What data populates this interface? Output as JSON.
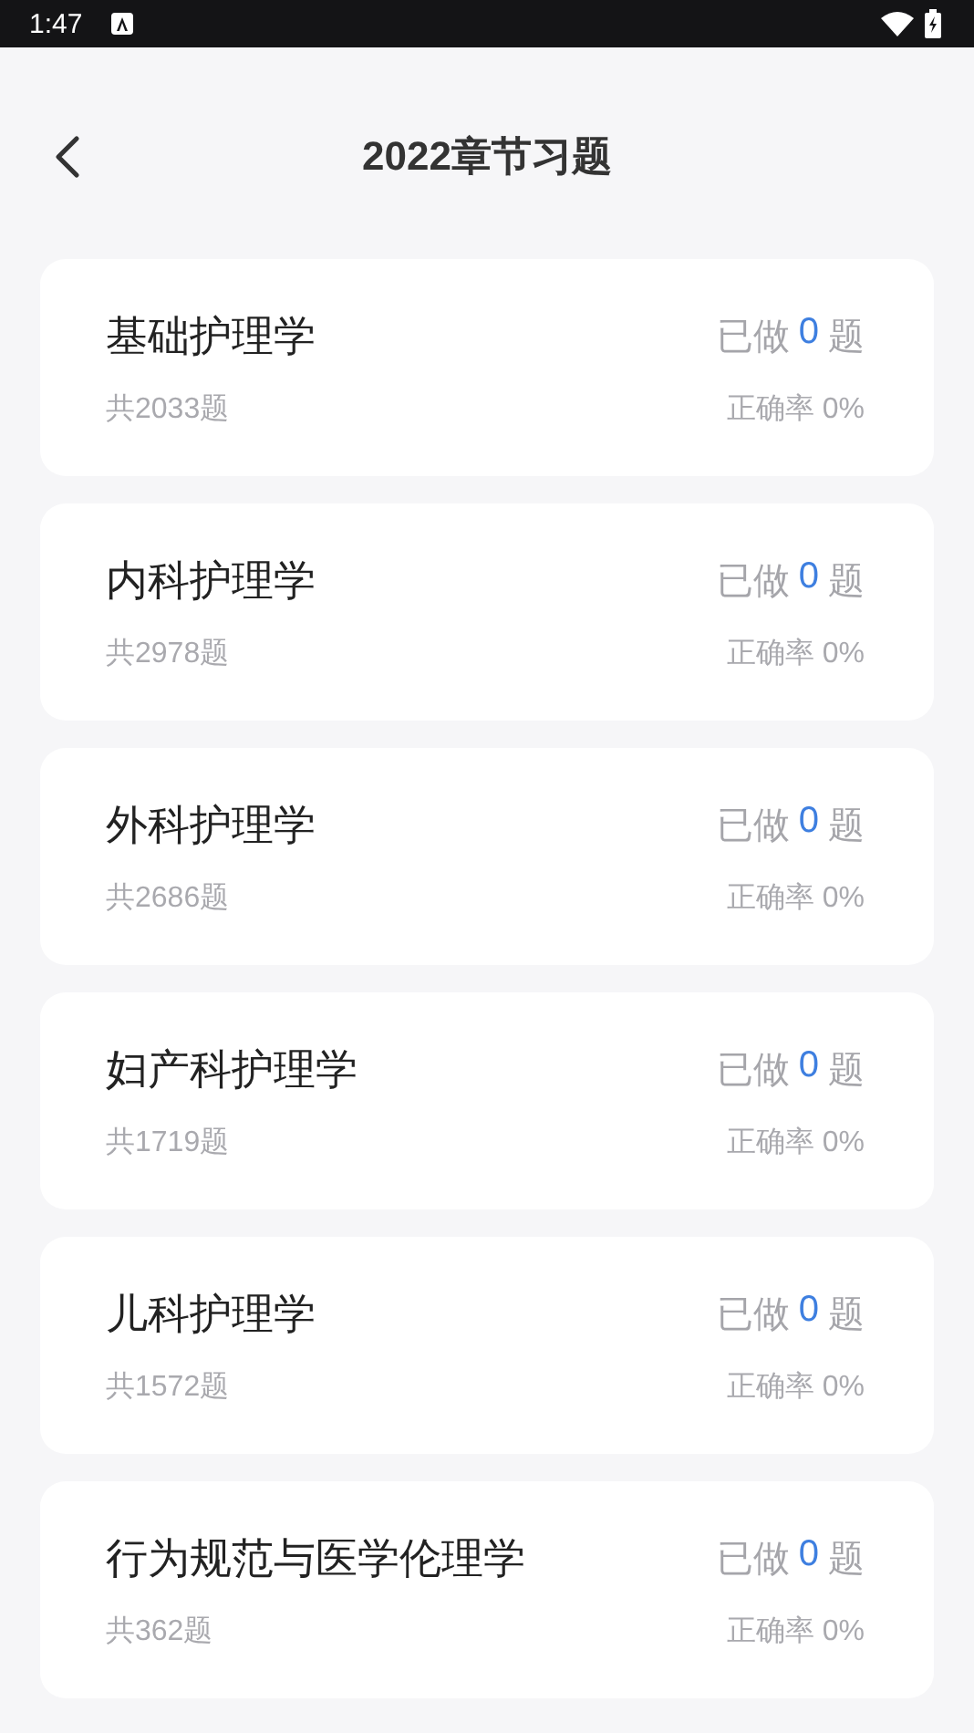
{
  "status_bar": {
    "time": "1:47"
  },
  "header": {
    "title": "2022章节习题"
  },
  "chapters": [
    {
      "name": "基础护理学",
      "total": "共2033题",
      "done_prefix": "已做",
      "done_count": "0",
      "done_suffix": "题",
      "accuracy": "正确率 0%"
    },
    {
      "name": "内科护理学",
      "total": "共2978题",
      "done_prefix": "已做",
      "done_count": "0",
      "done_suffix": "题",
      "accuracy": "正确率 0%"
    },
    {
      "name": "外科护理学",
      "total": "共2686题",
      "done_prefix": "已做",
      "done_count": "0",
      "done_suffix": "题",
      "accuracy": "正确率 0%"
    },
    {
      "name": "妇产科护理学",
      "total": "共1719题",
      "done_prefix": "已做",
      "done_count": "0",
      "done_suffix": "题",
      "accuracy": "正确率 0%"
    },
    {
      "name": "儿科护理学",
      "total": "共1572题",
      "done_prefix": "已做",
      "done_count": "0",
      "done_suffix": "题",
      "accuracy": "正确率 0%"
    },
    {
      "name": "行为规范与医学伦理学",
      "total": "共362题",
      "done_prefix": "已做",
      "done_count": "0",
      "done_suffix": "题",
      "accuracy": "正确率 0%"
    }
  ]
}
